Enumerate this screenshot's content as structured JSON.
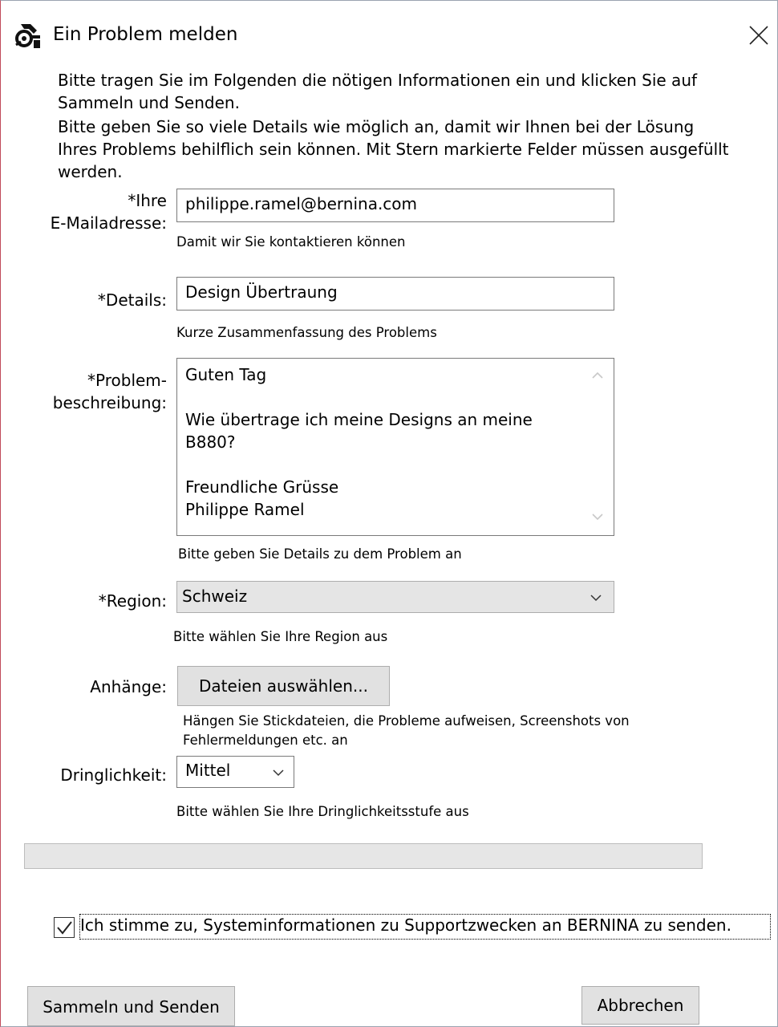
{
  "window": {
    "title": "Ein Problem melden",
    "app_icon": "sewing-machine-icon",
    "close_icon": "close-icon"
  },
  "intro": {
    "line1": "Bitte tragen Sie im Folgenden die nötigen Informationen ein und klicken Sie auf",
    "line2": "Sammeln und Senden.",
    "line3": "Bitte geben Sie so viele Details wie möglich an, damit wir Ihnen bei der Lösung",
    "line4": "Ihres Problems behilflich sein können. Mit Stern markierte Felder müssen ausgefüllt",
    "line5": "werden."
  },
  "email": {
    "label_line1": "*Ihre",
    "label_line2": "E-Mailadresse:",
    "value": "philippe.ramel@bernina.com",
    "hint": "Damit wir Sie kontaktieren können"
  },
  "details": {
    "label": "*Details:",
    "value": "Design Übertraung",
    "hint": "Kurze Zusammenfassung des Problems"
  },
  "description": {
    "label_line1": "*Problem-",
    "label_line2": "beschreibung:",
    "value": "Guten Tag\n\nWie übertrage ich meine Designs an meine\nB880?\n\nFreundliche Grüsse\nPhilippe Ramel",
    "hint": "Bitte geben Sie Details zu dem Problem an"
  },
  "region": {
    "label": "*Region:",
    "value": "Schweiz",
    "hint": "Bitte wählen Sie Ihre Region aus"
  },
  "attachments": {
    "label": "Anhänge:",
    "button": "Dateien auswählen...",
    "hint_line1": "Hängen Sie Stickdateien, die Probleme aufweisen, Screenshots von",
    "hint_line2": "Fehlermeldungen etc. an"
  },
  "urgency": {
    "label": "Dringlichkeit:",
    "value": "Mittel",
    "hint": "Bitte wählen Sie Ihre Dringlichkeitsstufe aus"
  },
  "progress": {
    "value": 0
  },
  "consent": {
    "checked": true,
    "label": "Ich stimme zu, Systeminformationen zu Supportzwecken an BERNINA zu senden."
  },
  "buttons": {
    "submit": "Sammeln und Senden",
    "cancel": "Abbrechen"
  }
}
